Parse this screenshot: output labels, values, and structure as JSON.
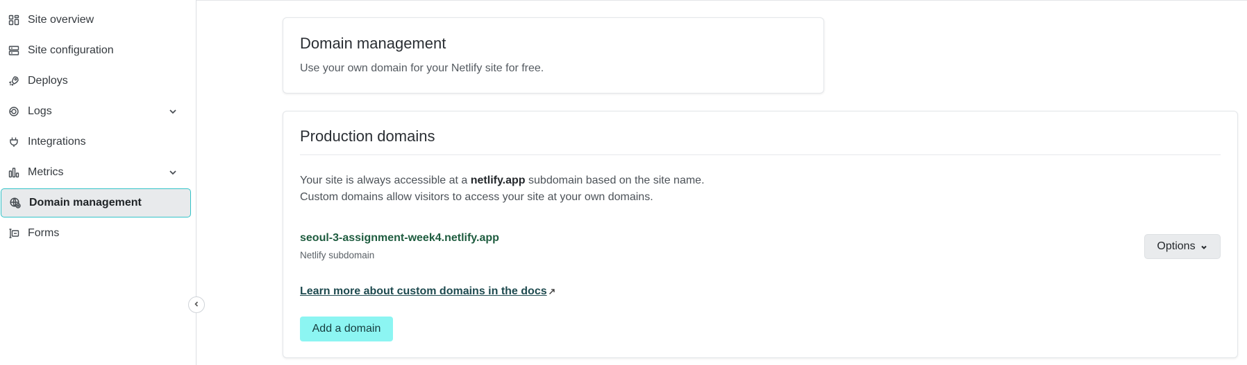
{
  "sidebar": {
    "items": [
      {
        "label": "Site overview",
        "icon": "grid-icon"
      },
      {
        "label": "Site configuration",
        "icon": "config-icon"
      },
      {
        "label": "Deploys",
        "icon": "rocket-icon"
      },
      {
        "label": "Logs",
        "icon": "logs-icon",
        "expandable": true
      },
      {
        "label": "Integrations",
        "icon": "plug-icon"
      },
      {
        "label": "Metrics",
        "icon": "bar-chart-icon",
        "expandable": true
      },
      {
        "label": "Domain management",
        "icon": "globe-icon",
        "active": true
      },
      {
        "label": "Forms",
        "icon": "form-icon"
      }
    ]
  },
  "domain_card": {
    "title": "Domain management",
    "subtitle": "Use your own domain for your Netlify site for free."
  },
  "production": {
    "title": "Production domains",
    "desc_before": "Your site is always accessible at a ",
    "desc_bold": "netlify.app",
    "desc_after": " subdomain based on the site name. Custom domains allow visitors to access your site at your own domains.",
    "domain": "seoul-3-assignment-week4.netlify.app",
    "domain_type": "Netlify subdomain",
    "options_label": "Options",
    "learn_more": "Learn more about custom domains in the docs",
    "add_domain_label": "Add a domain"
  },
  "colors": {
    "accent": "#8cf5f2",
    "active_border": "#32c3c8",
    "domain_text": "#1e5c3f"
  }
}
